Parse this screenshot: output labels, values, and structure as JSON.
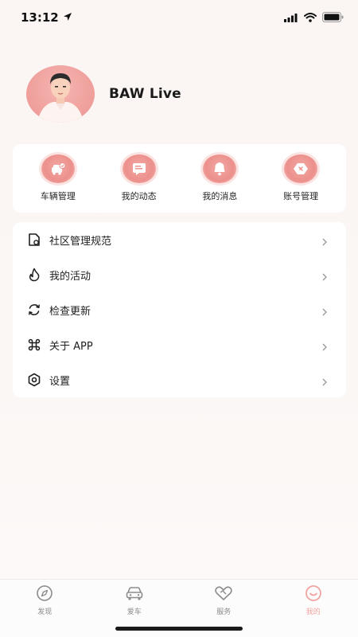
{
  "status_bar": {
    "time": "13:12",
    "icons": [
      "location-arrow-icon",
      "signal-icon",
      "wifi-icon",
      "battery-icon"
    ]
  },
  "profile": {
    "username": "BAW Live",
    "avatar_icon": "user-avatar-icon"
  },
  "quick_actions": [
    {
      "label": "车辆管理",
      "icon": "vehicle-icon"
    },
    {
      "label": "我的动态",
      "icon": "posts-icon"
    },
    {
      "label": "我的消息",
      "icon": "bell-icon"
    },
    {
      "label": "账号管理",
      "icon": "account-icon"
    }
  ],
  "menu": [
    {
      "label": "社区管理规范",
      "icon": "document-icon"
    },
    {
      "label": "我的活动",
      "icon": "flame-icon"
    },
    {
      "label": "检查更新",
      "icon": "refresh-icon"
    },
    {
      "label": "关于 APP",
      "icon": "command-icon"
    },
    {
      "label": "设置",
      "icon": "settings-hexagon-icon"
    }
  ],
  "tab_bar": {
    "tabs": [
      {
        "label": "发现",
        "icon": "compass-icon",
        "active": false
      },
      {
        "label": "爱车",
        "icon": "car-icon",
        "active": false
      },
      {
        "label": "服务",
        "icon": "handshake-heart-icon",
        "active": false
      },
      {
        "label": "我的",
        "icon": "smile-icon",
        "active": true
      }
    ]
  },
  "colors": {
    "accent": "#f2a3a0",
    "avatar_bg": "#ef9e9b",
    "background": "#fbf6f4"
  }
}
